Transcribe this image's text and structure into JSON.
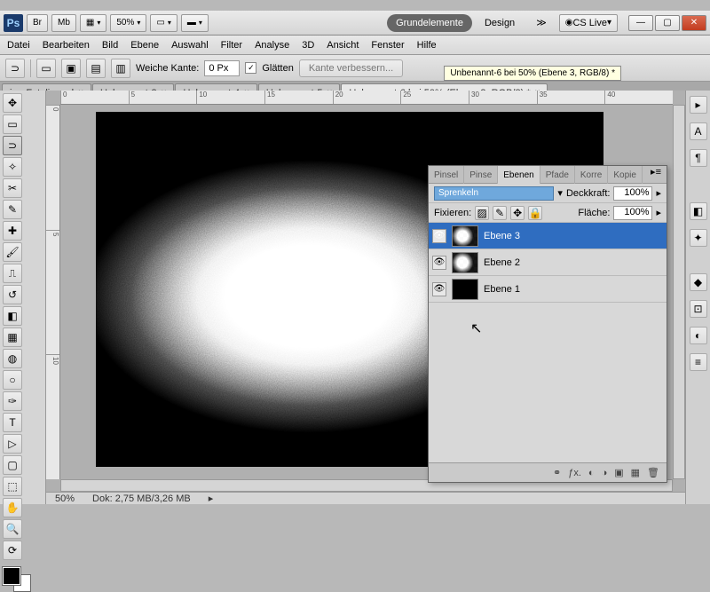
{
  "title": {
    "zoom": "50%",
    "workspace_active": "Grundelemente",
    "workspace_other": "Design",
    "cslive": "CS Live"
  },
  "menu": [
    "Datei",
    "Bearbeiten",
    "Bild",
    "Ebene",
    "Auswahl",
    "Filter",
    "Analyse",
    "3D",
    "Ansicht",
    "Fenster",
    "Hilfe"
  ],
  "optbar": {
    "feather_label": "Weiche Kante:",
    "feather_val": "0 Px",
    "antialias": "Glätten",
    "refine": "Kante verbessern..."
  },
  "tooltip": "Unbenannt-6 bei 50% (Ebene 3, RGB/8) *",
  "tabs": [
    {
      "label": "iu - Fotolia.psd",
      "active": false
    },
    {
      "label": "Unbenannt-3",
      "active": false
    },
    {
      "label": "Unbenannt-4",
      "active": false
    },
    {
      "label": "Unbenannt-5",
      "active": false
    },
    {
      "label": "Unbenannt-6 bei 50% (Ebene 3, RGB/8) *",
      "active": true
    }
  ],
  "ruler_h": [
    "0",
    "5",
    "10",
    "15",
    "20",
    "25",
    "30",
    "35",
    "40"
  ],
  "ruler_v": [
    "0",
    "5",
    "10"
  ],
  "status": {
    "zoom": "50%",
    "doc": "Dok: 2,75 MB/3,26 MB"
  },
  "panel": {
    "tabs": [
      "Pinsel",
      "Pinse",
      "Ebenen",
      "Pfade",
      "Korre",
      "Kopie"
    ],
    "active_tab": 2,
    "blend": "Sprenkeln",
    "opacity_label": "Deckkraft:",
    "opacity": "100%",
    "lock_label": "Fixieren:",
    "fill_label": "Fläche:",
    "fill": "100%",
    "layers": [
      {
        "name": "Ebene 3",
        "sel": true,
        "thumb": "checker"
      },
      {
        "name": "Ebene 2",
        "sel": false,
        "thumb": "checker"
      },
      {
        "name": "Ebene 1",
        "sel": false,
        "thumb": "black"
      }
    ]
  }
}
